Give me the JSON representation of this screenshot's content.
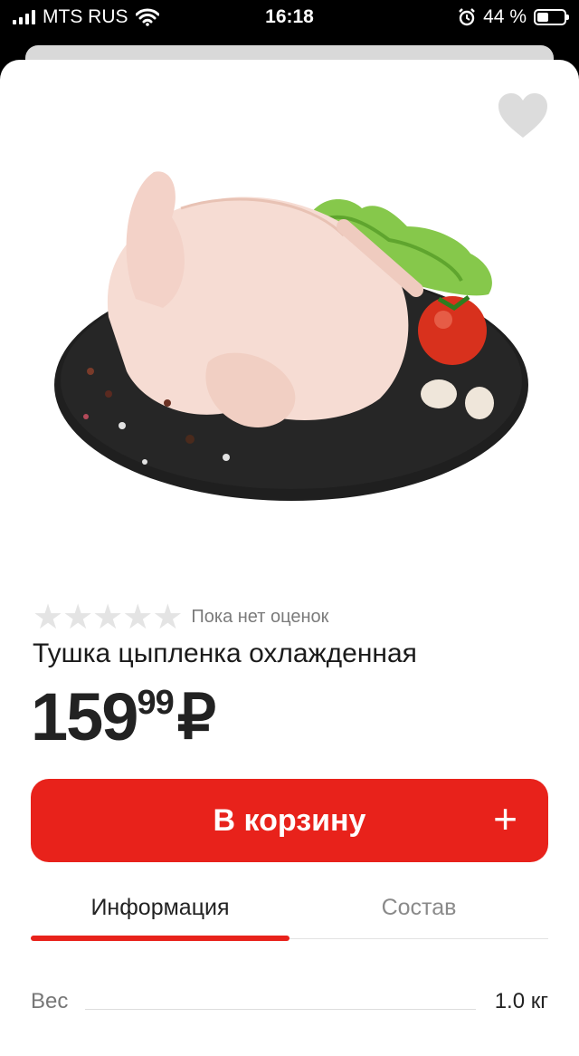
{
  "status_bar": {
    "carrier": "MTS RUS",
    "time": "16:18",
    "battery": "44 %",
    "battery_level": 0.44
  },
  "product": {
    "rating_stars": 5,
    "rating_text": "Пока нет оценок",
    "title": "Тушка цыпленка охлажденная",
    "price_main": "159",
    "price_cents": "99",
    "price_currency": "₽"
  },
  "actions": {
    "cart_label": "В корзину",
    "cart_plus": "+"
  },
  "tabs": [
    {
      "label": "Информация",
      "active": true
    },
    {
      "label": "Состав",
      "active": false
    }
  ],
  "specs": [
    {
      "label": "Вес",
      "value": "1.0 кг"
    }
  ],
  "colors": {
    "accent": "#e8221b",
    "star_inactive": "#e4e4e4",
    "favorite_icon": "#dcdcdc"
  },
  "icons": {
    "favorite": "heart-icon",
    "star": "star-icon",
    "signal": "signal-icon",
    "wifi": "wifi-icon",
    "alarm": "alarm-icon",
    "battery": "battery-icon"
  }
}
